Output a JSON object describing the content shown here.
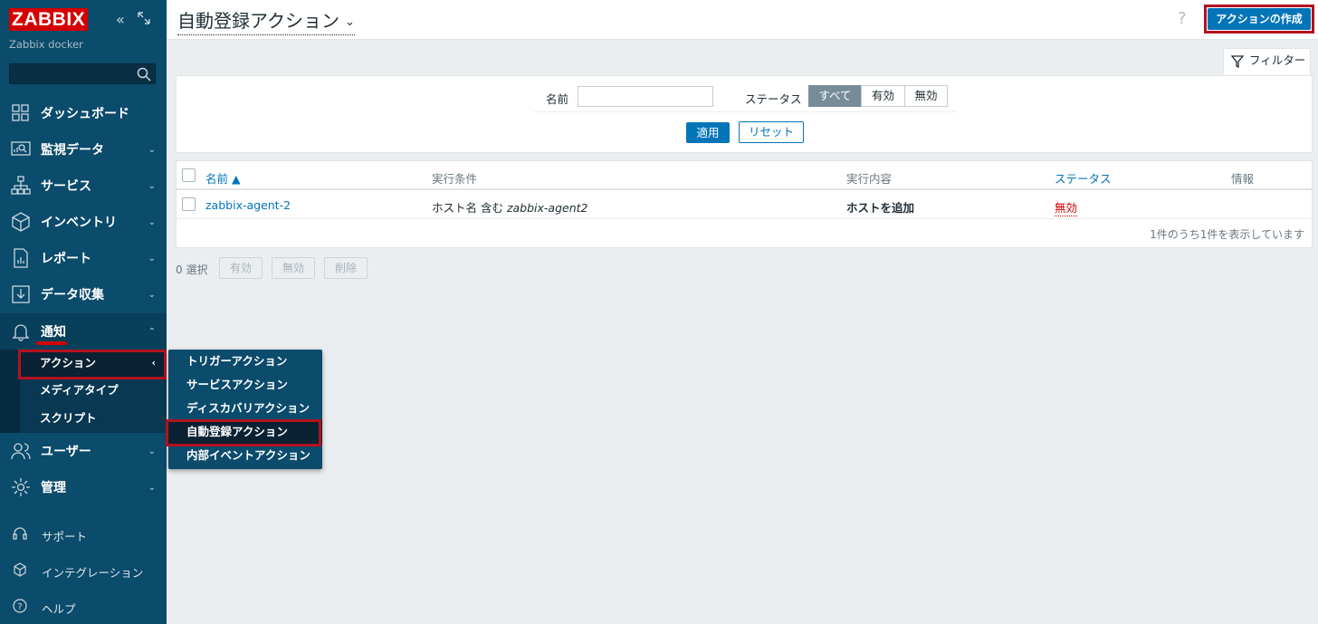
{
  "sidebar": {
    "logo": "ZABBIX",
    "server_name": "Zabbix docker",
    "search_placeholder": "",
    "items": [
      {
        "label": "ダッシュボード",
        "icon": "dashboard-icon"
      },
      {
        "label": "監視データ",
        "icon": "monitoring-icon"
      },
      {
        "label": "サービス",
        "icon": "services-icon"
      },
      {
        "label": "インベントリ",
        "icon": "inventory-icon"
      },
      {
        "label": "レポート",
        "icon": "reports-icon"
      },
      {
        "label": "データ収集",
        "icon": "data-collection-icon"
      },
      {
        "label": "通知",
        "icon": "bell-icon"
      },
      {
        "label": "ユーザー",
        "icon": "users-icon"
      },
      {
        "label": "管理",
        "icon": "gear-icon"
      }
    ],
    "submenu": [
      {
        "label": "アクション"
      },
      {
        "label": "メディアタイプ"
      },
      {
        "label": "スクリプト"
      }
    ],
    "footer": [
      {
        "label": "サポート",
        "icon": "headset-icon"
      },
      {
        "label": "インテグレーション",
        "icon": "integrations-icon"
      },
      {
        "label": "ヘルプ",
        "icon": "help-icon"
      }
    ]
  },
  "flyout": [
    {
      "label": "トリガーアクション"
    },
    {
      "label": "サービスアクション"
    },
    {
      "label": "ディスカバリアクション"
    },
    {
      "label": "自動登録アクション"
    },
    {
      "label": "内部イベントアクション"
    }
  ],
  "header": {
    "title": "自動登録アクション",
    "help": "?",
    "create_button": "アクションの作成"
  },
  "filter": {
    "tab_label": "フィルター",
    "name_label": "名前",
    "name_value": "",
    "status_label": "ステータス",
    "status_options": [
      "すべて",
      "有効",
      "無効"
    ],
    "status_selected": "すべて",
    "apply": "適用",
    "reset": "リセット"
  },
  "table": {
    "columns": [
      "名前 ▲",
      "実行条件",
      "実行内容",
      "ステータス",
      "情報"
    ],
    "rows": [
      {
        "name": "zabbix-agent-2",
        "condition_prefix": "ホスト名 含む ",
        "condition_value": "zabbix-agent2",
        "operation": "ホストを追加",
        "status": "無効",
        "info": ""
      }
    ],
    "count_text": "1件のうち1件を表示しています"
  },
  "mass_actions": {
    "selected": "0 選択",
    "enable": "有効",
    "disable": "無効",
    "delete": "削除"
  }
}
